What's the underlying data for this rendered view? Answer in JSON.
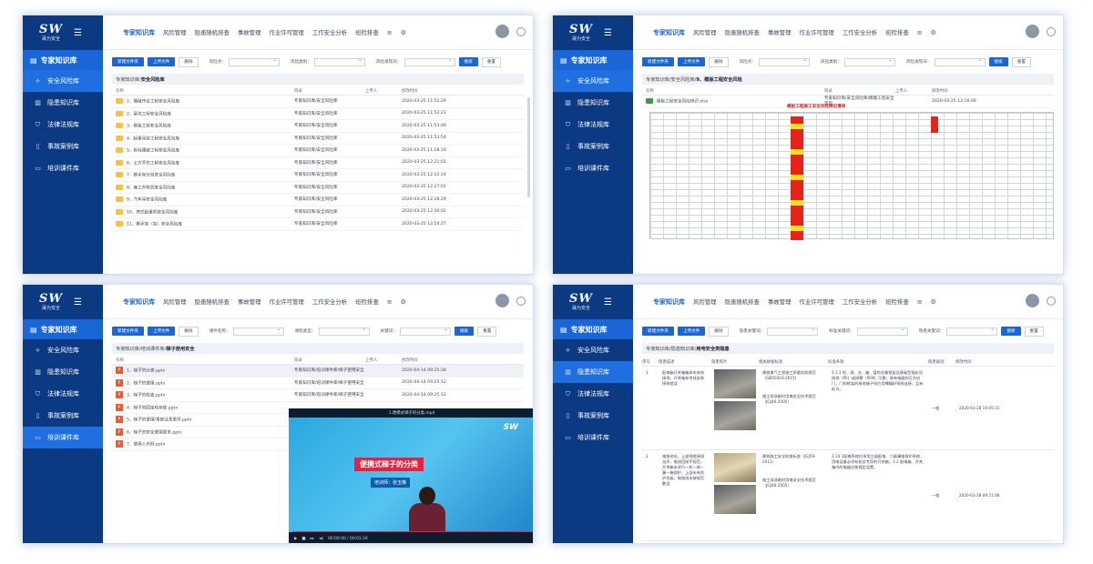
{
  "app": {
    "logo": "SW",
    "logo_sub": "晟为安全",
    "sidebar_title": "专家知识库",
    "sidebar_items": [
      "安全风险库",
      "隐患知识库",
      "法律法规库",
      "事故案例库",
      "培训课件库"
    ],
    "nav_items": [
      "专家知识库",
      "风险管理",
      "隐患随机排查",
      "事故管理",
      "作业许可管理",
      "工作安全分析",
      "班检排查"
    ]
  },
  "w1": {
    "toolbar": {
      "new": "新建文件夹",
      "upload": "上传文件",
      "delete": "删除"
    },
    "filters": [
      "风险点：",
      "风险类别：",
      "风险发现日："
    ],
    "search": "搜索",
    "reset": "重置",
    "crumb_prefix": "专家知识库/",
    "crumb_current": "安全风险库",
    "cols": [
      "名称",
      "",
      "目录",
      "上传人",
      "修改时间"
    ],
    "rows": [
      {
        "name": "1、爆破作业工程安全风险库",
        "path": "专家知识库/安全风险库",
        "time": "2020-03-25 11:52:29"
      },
      {
        "name": "2、基坑工程安全风险库",
        "path": "专家知识库/安全风险库",
        "time": "2020-03-25 11:52:23"
      },
      {
        "name": "3、模板工程安全风险库",
        "path": "专家知识库/安全风险库",
        "time": "2020-03-25 11:53:49"
      },
      {
        "name": "4、起重吊装工程安全风险库",
        "path": "专家知识库/安全风险库",
        "time": "2020-03-25 11:53:54"
      },
      {
        "name": "5、拆除爆破工程安全风险库",
        "path": "专家知识库/安全风险库",
        "time": "2020-03-25 11:28:19"
      },
      {
        "name": "6、土方开挖工程安全风险库",
        "path": "专家知识库/安全风险库",
        "time": "2020-03-25 12:21:01"
      },
      {
        "name": "7、脚手架分包安全风险库",
        "path": "专家知识库/安全风险库",
        "time": "2020-03-25 12:22:24"
      },
      {
        "name": "8、施工升降机安全风险库",
        "path": "专家知识库/安全风险库",
        "time": "2020-03-25 12:27:01"
      },
      {
        "name": "9、汽车吊安全风险库",
        "path": "专家知识库/安全风险库",
        "time": "2020-03-25 12:28:29"
      },
      {
        "name": "10、塔式起重机安全风险库",
        "path": "专家知识库/安全风险库",
        "time": "2020-03-25 12:30:02"
      },
      {
        "name": "11、脚手架（架）安全风险库",
        "path": "专家知识库/安全风险库",
        "time": "2020-03-25 12:54:27"
      }
    ]
  },
  "w2": {
    "toolbar": {
      "new": "新建文件夹",
      "upload": "上传文件",
      "delete": "删除"
    },
    "filters": [
      "风险点：",
      "风险类别：",
      "风险发现日："
    ],
    "search": "搜索",
    "reset": "重置",
    "crumb_prefix": "专家知识库/安全风险库/",
    "crumb_current": "9、模版工程安全风险",
    "cols": [
      "名称",
      "目录",
      "上传人",
      "修改时间"
    ],
    "file_name": "模板工程安全风险辨识.xlsx",
    "file_path": "专家知识库/安全风险库/模版工程安全风险",
    "file_time": "2020-03-25 12:16:06",
    "sheet_title": "模板工程施工安全风险辨识清单"
  },
  "w3": {
    "toolbar": {
      "new": "新建文件夹",
      "upload": "上传文件",
      "delete": "删除"
    },
    "filters": [
      "课件名称：",
      "课程类型：",
      "关键词："
    ],
    "search": "搜索",
    "reset": "重置",
    "crumb_prefix": "专家知识库/培训课件库/",
    "crumb_current": "梯子使用安全",
    "cols": [
      "名称",
      "目录",
      "上传人",
      "修改时间"
    ],
    "rows": [
      {
        "name": "1、梯子的分类.pptx",
        "path": "专家知识库/培训课件库/梯子使用安全",
        "time": "2020-04-14 09:25:28"
      },
      {
        "name": "2、梯子的使用.pptx",
        "path": "专家知识库/培训课件库/梯子使用安全",
        "time": "2020-04-14 09:25:12"
      },
      {
        "name": "3、梯子的检查.pptx",
        "path": "专家知识库/培训课件库/梯子使用安全",
        "time": "2020-04-14 09:25:12"
      },
      {
        "name": "4、梯子的固定和存放.pptx",
        "path": "",
        "time": ""
      },
      {
        "name": "5、梯子的使用/事故注意事项.pptx",
        "path": "",
        "time": ""
      },
      {
        "name": "6、梯子的安全使用要求.pptx",
        "path": "",
        "time": ""
      },
      {
        "name": "7、使用人示例.pptx",
        "path": "",
        "time": ""
      }
    ],
    "video": {
      "title": "1.便携式梯子的分类.mp4",
      "caption": "便携式梯子的分类",
      "presenter": "培训师：张玉琳",
      "time": "00:00:00 / 00:01:24"
    }
  },
  "w4": {
    "toolbar": {
      "new": "新建文件夹",
      "upload": "上传文件",
      "delete": "删除"
    },
    "filters": [
      "隐患关键词：",
      "标准关键词：",
      "隐患关键词："
    ],
    "search": "搜索",
    "reset": "重置",
    "crumb_prefix": "专家知识库/隐患知识库/",
    "crumb_current": "用电安全类隐患",
    "cols": [
      "序号",
      "隐患描述",
      "隐患照片",
      "相关依据标准",
      "标准条款",
      "隐患级别",
      "修改时间"
    ],
    "rows": [
      {
        "no": "1",
        "desc": "配电箱开关箱箱体未有效接地，开关箱参考线安装接线错误",
        "std1": "建筑电气工程施工质量验收规范（GB50303-2015）",
        "std2": "施工现场临时用电安全技术规范（JGJ46-2005）",
        "clause": "5.1.1 柜、屏、台、箱、盘的金属框架及基础型钢必须接地（PE）或接零（PEN）可靠；装有电器的可开启门，门和框架的接地端子间应用裸编织铜线连接，且有标识。",
        "level": "一般",
        "time": "2020-03-28 10:05:31"
      },
      {
        "no": "2",
        "desc": "电缆老化，上部线缆接线无序，电线搭接不规范，开关箱未进行一机一闸一漏一箱保护，上部未有防护挡板，电缆线未按规范敷设",
        "std1": "建筑施工安全检查标准（JGJ59-2011）",
        "std2": "施工现场临时用电安全技术规范（JGJ46-2005）",
        "clause": "3.14 1配电系统应采用三级配电、二级漏电保护系统，用电设备必须有各自专用的开关箱；3.2 配电箱、开关箱内的电器应按规定设置。",
        "level": "一般",
        "time": "2020-03-28 09:21:06"
      }
    ]
  }
}
